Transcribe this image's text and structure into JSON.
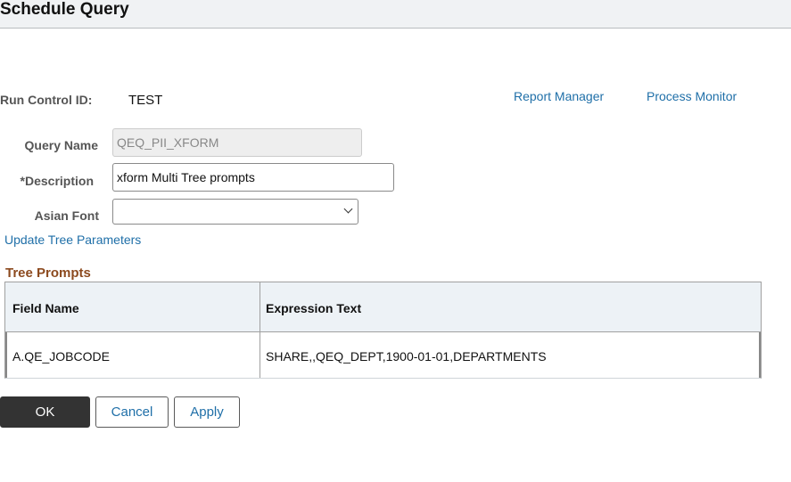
{
  "header": {
    "title": "Schedule Query"
  },
  "run_control": {
    "label": "Run Control ID:",
    "value": "TEST"
  },
  "links": {
    "report_manager": "Report Manager",
    "process_monitor": "Process Monitor",
    "update_tree_parameters": "Update Tree Parameters"
  },
  "form": {
    "query_name": {
      "label": "Query Name",
      "value": "QEQ_PII_XFORM"
    },
    "description": {
      "label": "*Description",
      "value": "xform Multi Tree prompts"
    },
    "asian_font": {
      "label": "Asian Font",
      "value": ""
    }
  },
  "tree_prompts": {
    "title": "Tree Prompts",
    "columns": [
      "Field Name",
      "Expression Text"
    ],
    "rows": [
      [
        "A.QE_JOBCODE",
        "SHARE,,QEQ_DEPT,1900-01-01,DEPARTMENTS"
      ]
    ]
  },
  "buttons": {
    "ok": "OK",
    "cancel": "Cancel",
    "apply": "Apply"
  },
  "colors": {
    "link": "#1f6fa8",
    "section_title": "#8c4a1f",
    "primary_button": "#333333"
  }
}
